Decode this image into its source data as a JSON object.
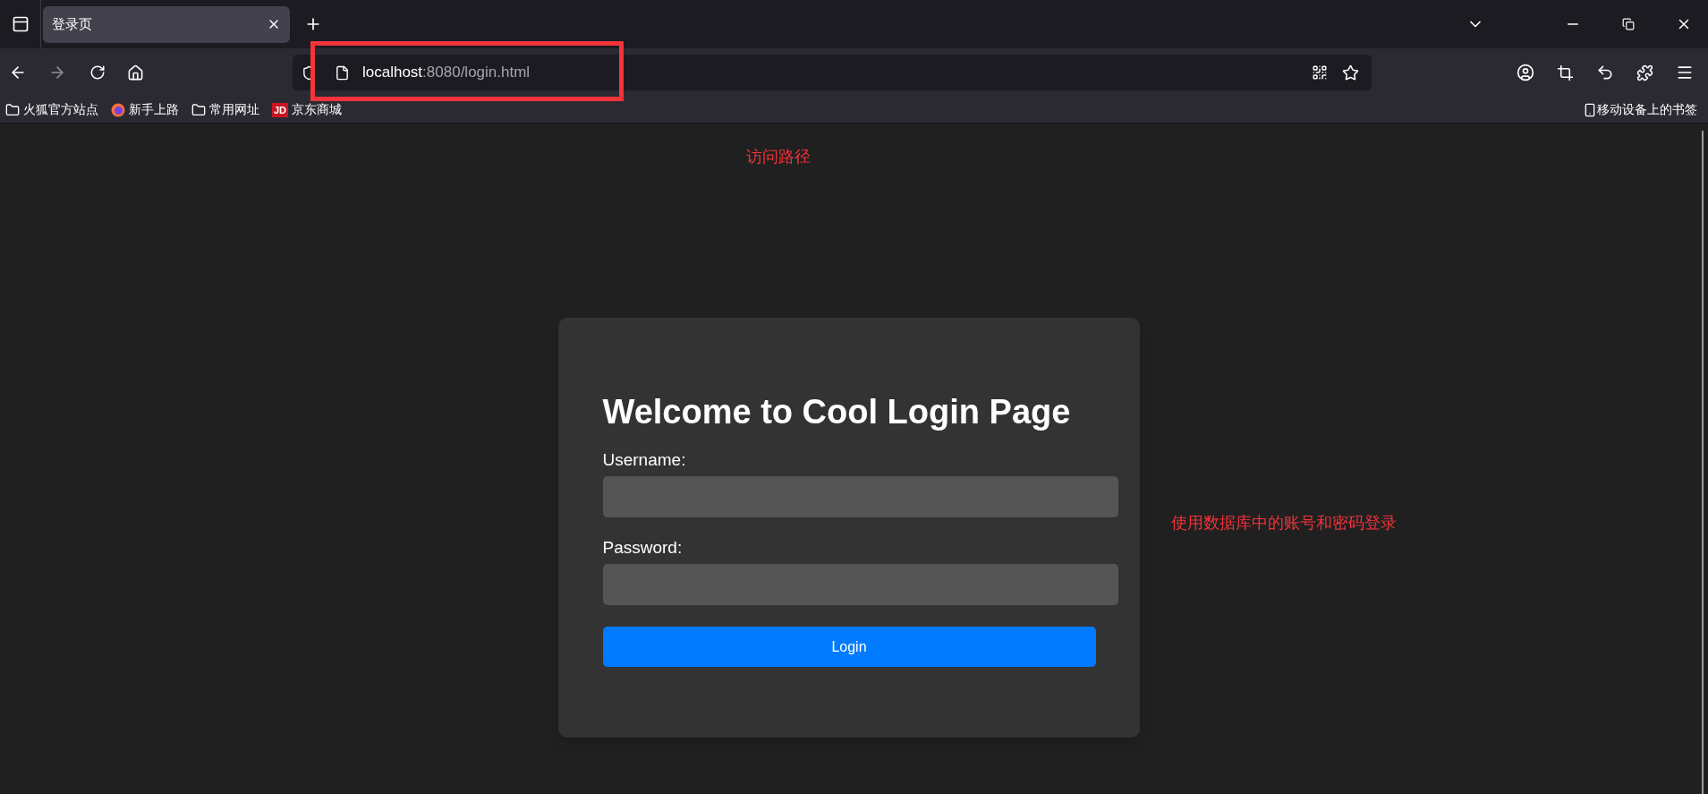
{
  "browser": {
    "tabs": [
      {
        "title": "登录页",
        "selected": true
      }
    ],
    "address_bar": {
      "host": "localhost",
      "path": ":8080/login.html"
    },
    "bookmarks": [
      {
        "label": "火狐官方站点",
        "kind": "folder"
      },
      {
        "label": "新手上路",
        "kind": "firefox"
      },
      {
        "label": "常用网址",
        "kind": "folder"
      },
      {
        "label": "京东商城",
        "kind": "jd",
        "icon_text": "JD"
      }
    ],
    "mobile_bookmarks": "移动设备上的书签"
  },
  "page": {
    "title": "Welcome to Cool Login Page",
    "fields": [
      {
        "label": "Username:"
      },
      {
        "label": "Password:"
      }
    ],
    "submit": "Login"
  },
  "annotations": [
    {
      "text": "访问路径",
      "kind": "url"
    },
    {
      "text": "使用数据库中的账号和密码登录",
      "kind": "form"
    }
  ]
}
